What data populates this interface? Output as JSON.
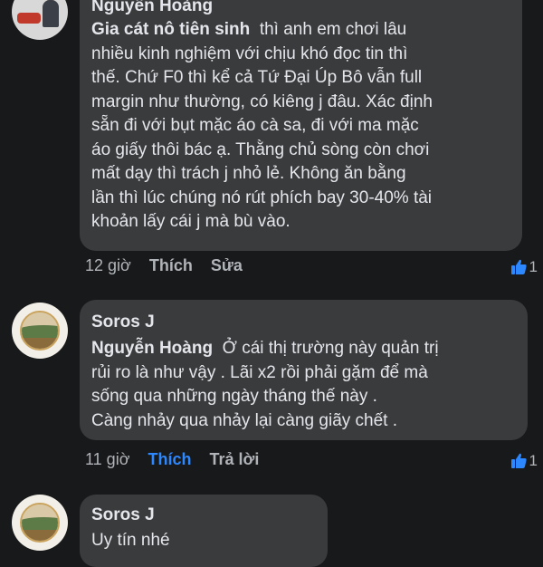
{
  "comments": [
    {
      "author": "Nguyễn Hoàng",
      "mention": "Gia cát nô tiên sinh",
      "lines": [
        "thì anh em chơi lâu",
        "nhiều kinh nghiệm với chịu khó đọc tin thì",
        "thế. Chứ F0 thì kể cả Tứ Đại Úp Bô vẫn full",
        "margin như thường, có kiêng j đâu. Xác định",
        "sẵn đi với bụt mặc áo cà sa, đi với ma mặc",
        "áo giấy thôi bác ạ. Thằng chủ sòng còn chơi",
        "mất dạy thì trách j nhỏ lẻ. Không ăn bằng",
        "lần thì lúc chúng nó rút phích bay 30-40% tài",
        "khoản lấy cái j mà bù vào."
      ],
      "time": "12 giờ",
      "like_label": "Thích",
      "secondary_label": "Sửa",
      "like_count": "1",
      "liked": false
    },
    {
      "author": "Soros J",
      "mention": "Nguyễn Hoàng",
      "lines": [
        "Ở cái thị trường này quản trị",
        "rủi ro là như vậy . Lãi x2 rồi phải gặm để mà",
        "sống qua những ngày tháng thế này .",
        "Càng nhảy qua nhảy lại càng giãy chết ."
      ],
      "time": "11 giờ",
      "like_label": "Thích",
      "secondary_label": "Trả lời",
      "like_count": "1",
      "liked": true
    },
    {
      "author": "Soros J",
      "lines": [
        "Uy tín nhé"
      ]
    }
  ],
  "colors": {
    "background": "#18191a",
    "bubble": "#3a3b3c",
    "text": "#e4e6eb",
    "muted": "#b0b3b8",
    "accent": "#2d88ff"
  },
  "icons": {
    "like": "thumbs-up-icon"
  }
}
